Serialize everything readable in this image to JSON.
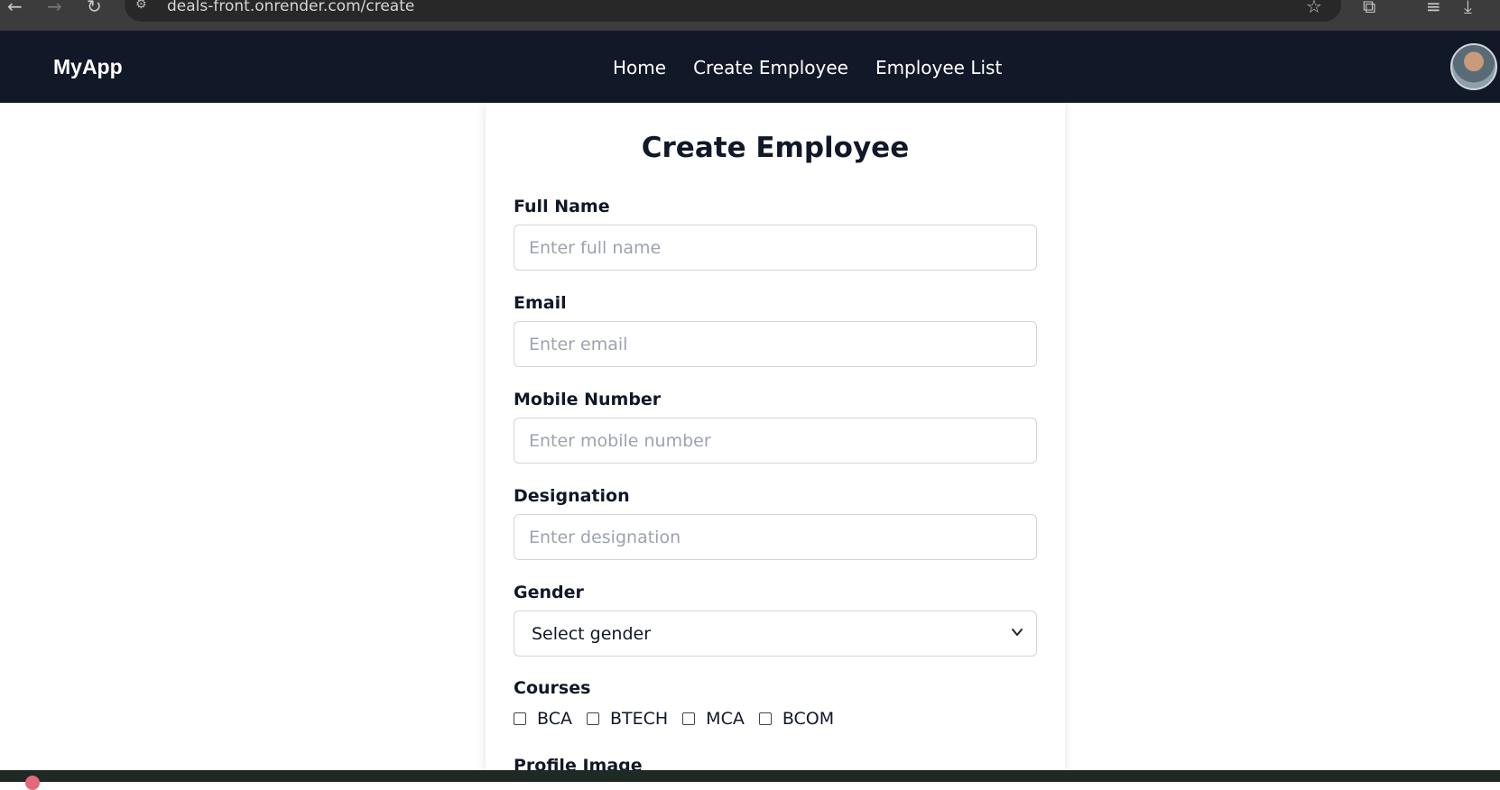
{
  "browser": {
    "url": "deals-front.onrender.com/create"
  },
  "navbar": {
    "brand": "MyApp",
    "links": [
      "Home",
      "Create Employee",
      "Employee List"
    ]
  },
  "form": {
    "title": "Create Employee",
    "full_name": {
      "label": "Full Name",
      "placeholder": "Enter full name",
      "value": ""
    },
    "email": {
      "label": "Email",
      "placeholder": "Enter email",
      "value": ""
    },
    "mobile": {
      "label": "Mobile Number",
      "placeholder": "Enter mobile number",
      "value": ""
    },
    "designation": {
      "label": "Designation",
      "placeholder": "Enter designation",
      "value": ""
    },
    "gender": {
      "label": "Gender",
      "selected": "Select gender"
    },
    "courses": {
      "label": "Courses",
      "options": [
        "BCA",
        "BTECH",
        "MCA",
        "BCOM"
      ]
    },
    "profile_image": {
      "label": "Profile Image"
    }
  }
}
